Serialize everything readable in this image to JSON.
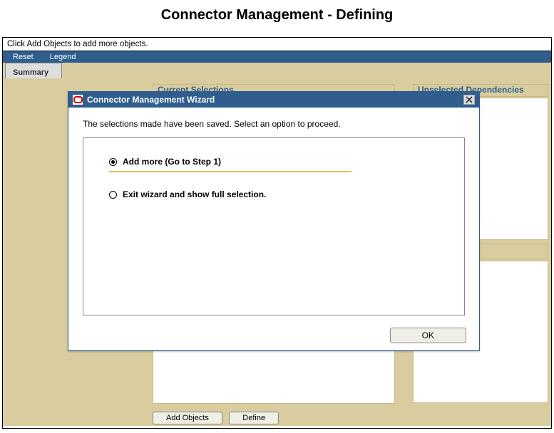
{
  "page_title": "Connector Management - Defining",
  "instruction": "Click Add Objects to add more objects.",
  "menu": {
    "reset": "Reset",
    "legend": "Legend"
  },
  "tab": {
    "summary": "Summary"
  },
  "panels": {
    "current_selections": "Current Selections",
    "unselected_dependencies": "Unselected Dependencies"
  },
  "buttons": {
    "add_objects": "Add Objects",
    "define": "Define",
    "ok": "OK"
  },
  "dialog": {
    "title": "Connector Management Wizard",
    "message": "The selections made have been saved. Select an option to proceed.",
    "opt_add_more": "Add more (Go to Step 1)",
    "opt_exit": "Exit wizard and show full selection."
  }
}
